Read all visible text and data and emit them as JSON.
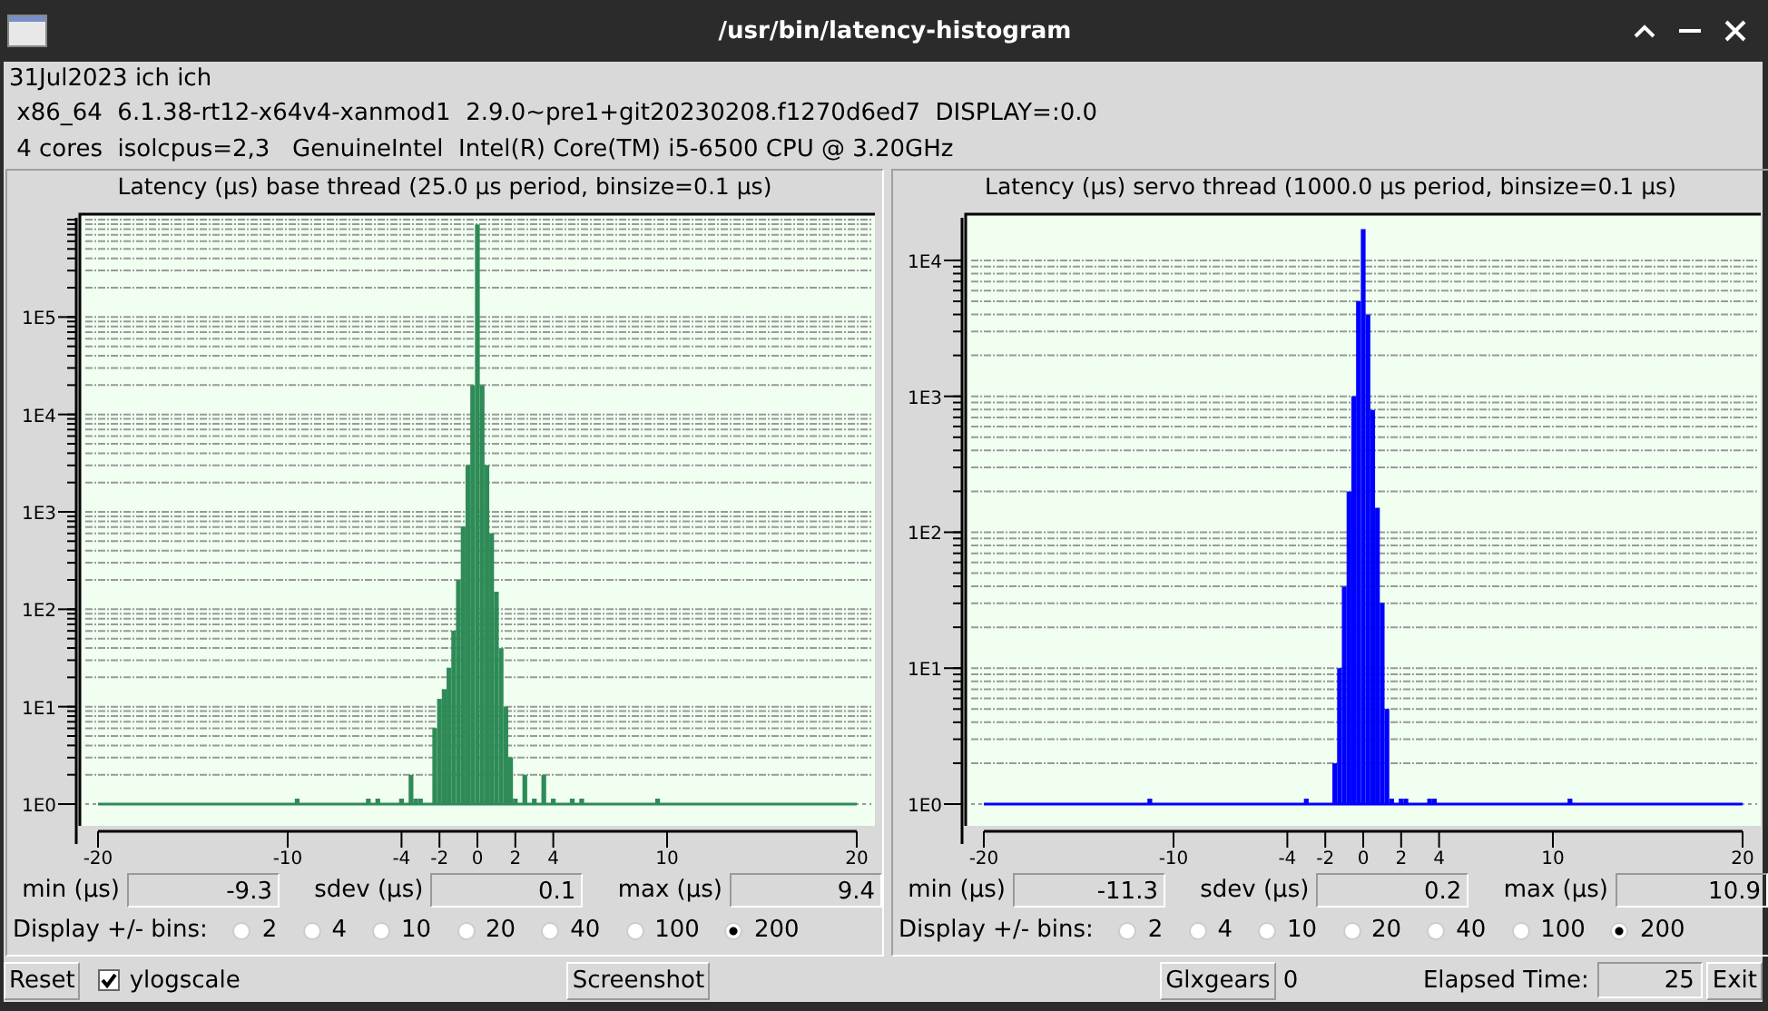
{
  "window": {
    "title": "/usr/bin/latency-histogram"
  },
  "info_lines": [
    "31Jul2023 ich ich",
    " x86_64  6.1.38-rt12-x64v4-xanmod1  2.9.0~pre1+git20230208.f1270d6ed7  DISPLAY=:0.0",
    " 4 cores  isolcpus=2,3   GenuineIntel  Intel(R) Core(TM) i5-6500 CPU @ 3.20GHz"
  ],
  "panels": [
    {
      "title": "Latency (µs) base thread (25.0 µs period, binsize=0.1 µs)",
      "y_axis_labels": [
        "1E5",
        "1E4",
        "1E3",
        "1E2",
        "1E1",
        "1E0"
      ],
      "x_axis_labels": [
        "-20",
        "-10",
        "-4",
        "-2",
        "0",
        "2",
        "4",
        "10",
        "20"
      ],
      "stats": [
        {
          "label": "min (µs)",
          "value": "-9.3"
        },
        {
          "label": "sdev (µs)",
          "value": "0.1"
        },
        {
          "label": "max (µs)",
          "value": "9.4"
        }
      ],
      "bins_label": "Display +/- bins:",
      "bins": [
        {
          "label": "2",
          "selected": false
        },
        {
          "label": "4",
          "selected": false
        },
        {
          "label": "10",
          "selected": false
        },
        {
          "label": "20",
          "selected": false
        },
        {
          "label": "40",
          "selected": false
        },
        {
          "label": "100",
          "selected": false
        },
        {
          "label": "200",
          "selected": true
        }
      ]
    },
    {
      "title": "Latency (µs) servo thread (1000.0 µs period, binsize=0.1 µs)",
      "y_axis_labels": [
        "1E4",
        "1E3",
        "1E2",
        "1E1",
        "1E0"
      ],
      "x_axis_labels": [
        "-20",
        "-10",
        "-4",
        "-2",
        "0",
        "2",
        "4",
        "10",
        "20"
      ],
      "stats": [
        {
          "label": "min (µs)",
          "value": "-11.3"
        },
        {
          "label": "sdev (µs)",
          "value": "0.2"
        },
        {
          "label": "max (µs)",
          "value": "10.9"
        }
      ],
      "bins_label": "Display +/- bins:",
      "bins": [
        {
          "label": "2",
          "selected": false
        },
        {
          "label": "4",
          "selected": false
        },
        {
          "label": "10",
          "selected": false
        },
        {
          "label": "20",
          "selected": false
        },
        {
          "label": "40",
          "selected": false
        },
        {
          "label": "100",
          "selected": false
        },
        {
          "label": "200",
          "selected": true
        }
      ]
    }
  ],
  "bottom_bar": {
    "reset": "Reset",
    "ylogscale": {
      "label": "ylogscale",
      "checked": true
    },
    "screenshot": "Screenshot",
    "glxgears": "Glxgears",
    "glxgears_count": "0",
    "elapsed_label": "Elapsed Time:",
    "elapsed_value": "25",
    "exit": "Exit"
  }
}
